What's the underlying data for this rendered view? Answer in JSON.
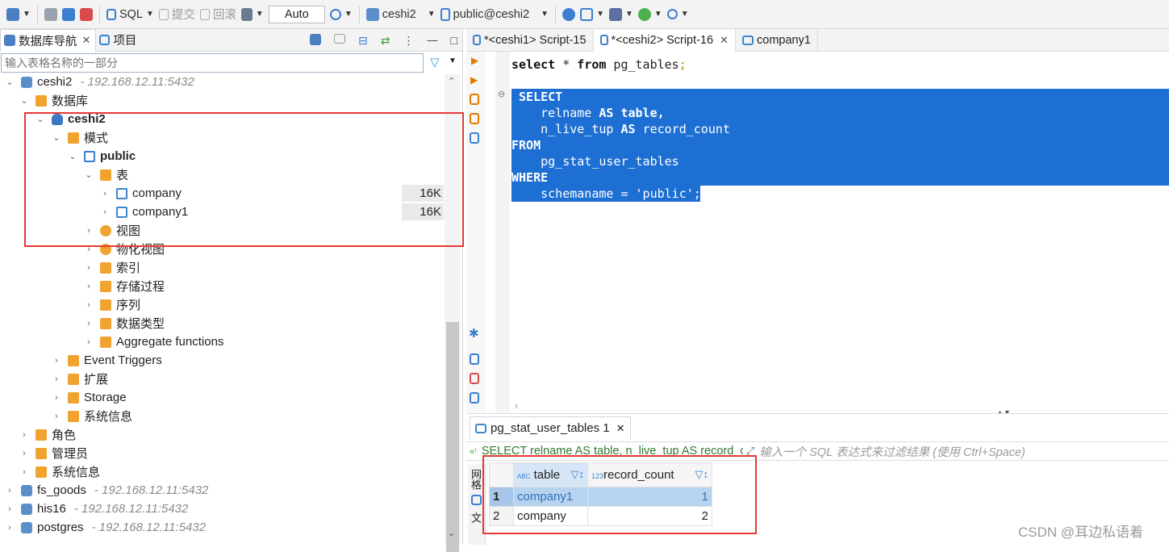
{
  "toolbar": {
    "sql_label": "SQL",
    "commit_label": "提交",
    "rollback_label": "回滚",
    "transaction_mode": "Auto",
    "datasource": "ceshi2",
    "schema": "public@ceshi2"
  },
  "navigator": {
    "tab_db_navigator": "数据库导航",
    "tab_projects": "项目",
    "filter_placeholder": "输入表格名称的一部分",
    "tree": {
      "conn1_name": "ceshi2",
      "conn1_host": "- 192.168.12.11:5432",
      "databases_label": "数据库",
      "db_name": "ceshi2",
      "schemas_label": "模式",
      "schema_name": "public",
      "tables_label": "表",
      "table1_name": "company",
      "table1_size": "16K",
      "table2_name": "company1",
      "table2_size": "16K",
      "views_label": "视图",
      "matviews_label": "物化视图",
      "indexes_label": "索引",
      "procedures_label": "存储过程",
      "sequences_label": "序列",
      "datatypes_label": "数据类型",
      "aggregate_label": "Aggregate functions",
      "event_triggers_label": "Event Triggers",
      "extensions_label": "扩展",
      "storage_label": "Storage",
      "sysinfo_label": "系统信息",
      "roles_label": "角色",
      "admins_label": "管理员",
      "sysinfo2_label": "系统信息",
      "conn2_name": "fs_goods",
      "conn2_host": "- 192.168.12.11:5432",
      "conn3_name": "his16",
      "conn3_host": "- 192.168.12.11:5432",
      "conn4_name": "postgres",
      "conn4_host": "- 192.168.12.11:5432"
    }
  },
  "editor": {
    "tabs": [
      "*<ceshi1> Script-15",
      "*<ceshi2> Script-16",
      "company1"
    ],
    "line1": "select * from pg_tables;",
    "q_select": "SELECT",
    "q_relname": "relname",
    "q_as": "AS",
    "q_table": "table,",
    "q_nlive": "n_live_tup",
    "q_rc": "record_count",
    "q_from": "FROM",
    "q_pgstat": "pg_stat_user_tables",
    "q_where": "WHERE",
    "q_cond": "schemaname = 'public';"
  },
  "results": {
    "tab_label": "pg_stat_user_tables 1",
    "sql_text": "SELECT relname AS table, n_live_tup AS record_count FROM pg_stat_user_tables WHERE schemaname = 'public'",
    "filter_hint": "输入一个 SQL 表达式来过滤结果 (使用 Ctrl+Space)",
    "columns": [
      "table",
      "record_count"
    ],
    "col1_type": "ABC",
    "col2_type": "123",
    "rows": [
      {
        "num": "1",
        "table": "company1",
        "record_count": "1"
      },
      {
        "num": "2",
        "table": "company",
        "record_count": "2"
      }
    ]
  },
  "watermark": "CSDN @耳边私语着",
  "colors": {
    "selection": "#1e6fd3",
    "highlight_box": "#e53935",
    "folder": "#f0a32e"
  }
}
